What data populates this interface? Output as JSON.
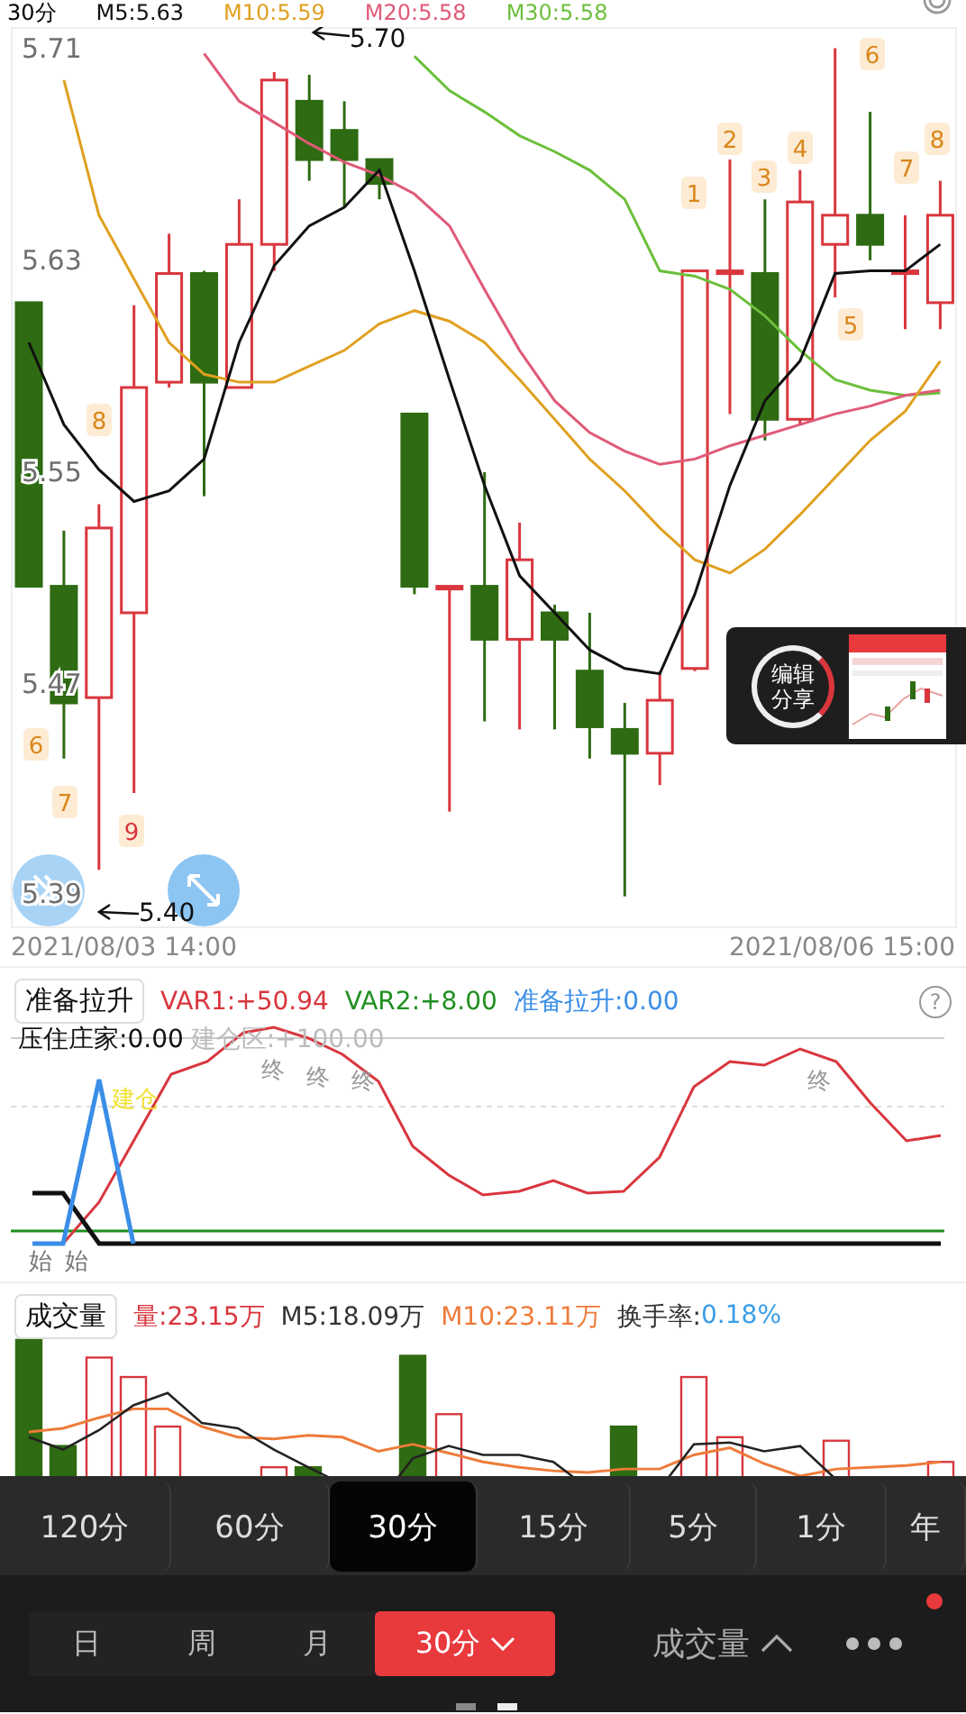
{
  "period_label": "30分",
  "chart_data": {
    "type": "candlestick",
    "yticks": [
      5.71,
      5.63,
      5.55,
      5.47,
      5.39
    ],
    "ylim": [
      5.378,
      5.718
    ],
    "ohlc": [
      [
        5.614,
        5.614,
        5.507,
        5.507
      ],
      [
        5.507,
        5.528,
        5.442,
        5.463
      ],
      [
        5.465,
        5.538,
        5.4,
        5.529
      ],
      [
        5.497,
        5.613,
        5.429,
        5.582
      ],
      [
        5.584,
        5.64,
        5.582,
        5.625
      ],
      [
        5.625,
        5.626,
        5.541,
        5.584
      ],
      [
        5.582,
        5.653,
        5.582,
        5.636
      ],
      [
        5.636,
        5.701,
        5.626,
        5.698
      ],
      [
        5.69,
        5.7,
        5.66,
        5.668
      ],
      [
        5.679,
        5.69,
        5.65,
        5.668
      ],
      [
        5.668,
        5.668,
        5.653,
        5.659
      ],
      [
        5.572,
        5.572,
        5.504,
        5.507
      ],
      [
        5.506,
        5.507,
        5.422,
        5.507
      ],
      [
        5.507,
        5.55,
        5.456,
        5.487
      ],
      [
        5.487,
        5.531,
        5.453,
        5.517
      ],
      [
        5.497,
        5.5,
        5.453,
        5.487
      ],
      [
        5.475,
        5.497,
        5.442,
        5.454
      ],
      [
        5.453,
        5.463,
        5.39,
        5.444
      ],
      [
        5.444,
        5.475,
        5.432,
        5.464
      ],
      [
        5.476,
        5.626,
        5.475,
        5.626
      ],
      [
        5.625,
        5.668,
        5.572,
        5.626
      ],
      [
        5.625,
        5.653,
        5.562,
        5.57
      ],
      [
        5.57,
        5.664,
        5.568,
        5.652
      ],
      [
        5.636,
        5.71,
        5.616,
        5.647
      ],
      [
        5.647,
        5.686,
        5.63,
        5.636
      ],
      [
        5.625,
        5.647,
        5.604,
        5.626
      ],
      [
        5.614,
        5.66,
        5.604,
        5.647
      ]
    ]
  },
  "moving_averages": {
    "chart_data": {
      "type": "line",
      "ylim": [
        5.378,
        5.718
      ],
      "series": [
        {
          "name": "M5:5.63",
          "color": "#111111",
          "values": [
            5.599,
            5.568,
            5.551,
            5.539,
            5.543,
            5.555,
            5.599,
            5.628,
            5.643,
            5.65,
            5.664,
            5.626,
            5.585,
            5.545,
            5.511,
            5.497,
            5.483,
            5.476,
            5.474,
            5.504,
            5.545,
            5.577,
            5.592,
            5.625,
            5.626,
            5.626,
            5.636
          ]
        },
        {
          "name": "M10:5.59",
          "color": "#e0a020",
          "values": [
            null,
            5.698,
            5.647,
            5.623,
            5.599,
            5.587,
            5.584,
            5.584,
            5.59,
            5.596,
            5.606,
            5.611,
            5.607,
            5.599,
            5.585,
            5.57,
            5.555,
            5.543,
            5.529,
            5.517,
            5.512,
            5.521,
            5.534,
            5.548,
            5.562,
            5.573,
            5.592
          ]
        },
        {
          "name": "M20:5.58",
          "color": "#e05a78",
          "values": [
            null,
            null,
            null,
            null,
            null,
            5.708,
            5.69,
            5.682,
            5.674,
            5.667,
            5.662,
            5.655,
            5.643,
            5.619,
            5.596,
            5.577,
            5.565,
            5.558,
            5.553,
            5.555,
            5.56,
            5.564,
            5.568,
            5.572,
            5.575,
            5.579,
            5.581
          ]
        },
        {
          "name": "M30:5.58",
          "color": "#6cbf3c",
          "values": [
            null,
            null,
            null,
            null,
            null,
            null,
            null,
            null,
            null,
            null,
            null,
            5.707,
            5.694,
            5.686,
            5.677,
            5.671,
            5.664,
            5.653,
            5.626,
            5.624,
            5.619,
            5.609,
            5.596,
            5.585,
            5.581,
            5.579,
            5.58
          ]
        }
      ]
    }
  },
  "high_marker": "5.70",
  "low_marker": "5.40",
  "signal_tags": [
    {
      "text": "8",
      "color": "#d9861a"
    },
    {
      "text": "6",
      "color": "#d9861a"
    },
    {
      "text": "7",
      "color": "#d9861a"
    },
    {
      "text": "9",
      "color": "#d9363e"
    },
    {
      "text": "1",
      "color": "#d9861a"
    },
    {
      "text": "2",
      "color": "#d9861a"
    },
    {
      "text": "3",
      "color": "#d9861a"
    },
    {
      "text": "4",
      "color": "#d9861a"
    },
    {
      "text": "5",
      "color": "#d9861a"
    },
    {
      "text": "6",
      "color": "#d9861a"
    },
    {
      "text": "7",
      "color": "#d9861a"
    },
    {
      "text": "8",
      "color": "#d9861a"
    }
  ],
  "share_popup": {
    "lines": [
      "编辑",
      "分享"
    ]
  },
  "date_start": "2021/08/03 14:00",
  "date_end": "2021/08/06 15:00",
  "indicator": {
    "button": "准备拉升",
    "values": [
      {
        "text": "VAR1:+50.94",
        "color": "#d9363e"
      },
      {
        "text": "VAR2:+8.00",
        "color": "#1f8f1f"
      },
      {
        "text": "准备拉升:0.00",
        "color": "#3a8ee8"
      }
    ],
    "help": "?",
    "second_row": [
      {
        "text": "压住庄家:0.00",
        "color": "#111111"
      },
      {
        "text": "建仓区:+100.00",
        "color": "#bbbbbb"
      }
    ],
    "marks": [
      {
        "text": "终",
        "color": "#999999"
      },
      {
        "text": "终",
        "color": "#999999"
      },
      {
        "text": "终",
        "color": "#999999"
      },
      {
        "text": "终",
        "color": "#999999"
      },
      {
        "text": "建仓",
        "color": "#f0e030"
      },
      {
        "text": "始",
        "color": "#777777"
      },
      {
        "text": "始",
        "color": "#777777"
      }
    ]
  },
  "volume": {
    "button": "成交量",
    "values": [
      {
        "text": "量:23.15万",
        "color": "#d9363e"
      },
      {
        "text": "M5:18.09万",
        "color": "#333333"
      },
      {
        "text": "M10:23.11万",
        "color": "#ee7b3a"
      },
      {
        "text": "换手率:",
        "color": "#333333"
      },
      {
        "text": "0.18%",
        "color": "#3a9ee8"
      }
    ]
  },
  "periods": [
    {
      "label": "120分",
      "selected": false
    },
    {
      "label": "60分",
      "selected": false
    },
    {
      "label": "30分",
      "selected": true
    },
    {
      "label": "15分",
      "selected": false
    },
    {
      "label": "5分",
      "selected": false
    },
    {
      "label": "1分",
      "selected": false
    },
    {
      "label": "年",
      "selected": false
    }
  ],
  "bottom_tabs": [
    {
      "label": "日",
      "selected": false
    },
    {
      "label": "周",
      "selected": false
    },
    {
      "label": "月",
      "selected": false
    },
    {
      "label": "30分",
      "selected": true
    }
  ],
  "volume_toggle": "成交量",
  "unread": true
}
